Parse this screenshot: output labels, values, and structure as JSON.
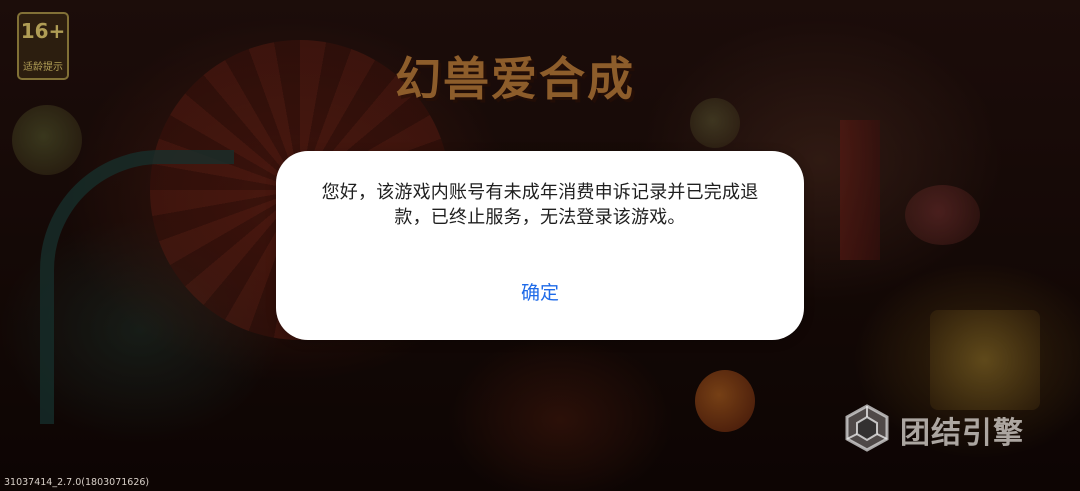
{
  "age_rating": {
    "number": "16+",
    "label": "适龄提示"
  },
  "game_logo": {
    "text": "幻兽爱合成"
  },
  "dialog": {
    "message": "您好，该游戏内账号有未成年消费申诉记录并已完成退款，已终止服务，无法登录该游戏。",
    "confirm_label": "确定"
  },
  "engine_watermark": {
    "text": "团结引擎",
    "icon": "cube-icon"
  },
  "build_info": "31037414_2.7.0(1803071626)",
  "colors": {
    "dialog_background": "#ffffff",
    "message_text": "#1f1f1f",
    "confirm_text": "#1e6ae8"
  }
}
